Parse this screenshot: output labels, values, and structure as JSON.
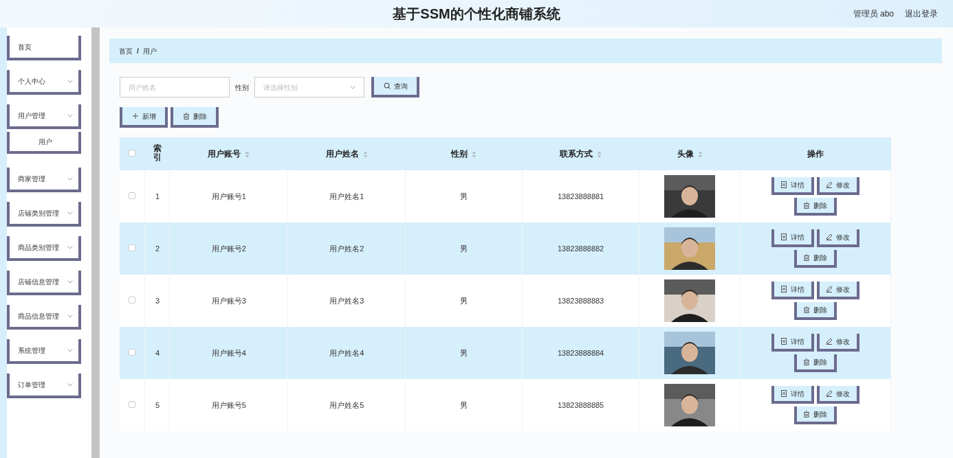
{
  "header": {
    "title": "基于SSM的个性化商铺系统",
    "user": "管理员 abo",
    "logout": "退出登录"
  },
  "sidebar": {
    "items": [
      {
        "label": "首页",
        "kind": "link"
      },
      {
        "label": "个人中心",
        "kind": "menu"
      },
      {
        "label": "用户管理",
        "kind": "menu",
        "children": [
          {
            "label": "用户"
          }
        ]
      },
      {
        "label": "商家管理",
        "kind": "menu"
      },
      {
        "label": "店铺类别管理",
        "kind": "menu"
      },
      {
        "label": "商品类别管理",
        "kind": "menu"
      },
      {
        "label": "店铺信息管理",
        "kind": "menu"
      },
      {
        "label": "商品信息管理",
        "kind": "menu"
      },
      {
        "label": "系统管理",
        "kind": "menu"
      },
      {
        "label": "订单管理",
        "kind": "menu"
      }
    ]
  },
  "breadcrumb": {
    "items": [
      "首页",
      "用户"
    ],
    "separator": "/"
  },
  "search": {
    "name_placeholder": "用户姓名",
    "gender_label": "性别",
    "gender_placeholder": "请选择性别",
    "query_button": "查询"
  },
  "actions": [
    "新增",
    "删除"
  ],
  "table": {
    "select_all_checked": false,
    "columns": [
      {
        "label": "索引",
        "sortable": false
      },
      {
        "label": "用户账号",
        "sortable": true
      },
      {
        "label": "用户姓名",
        "sortable": true
      },
      {
        "label": "性别",
        "sortable": true
      },
      {
        "label": "联系方式",
        "sortable": true
      },
      {
        "label": "头像",
        "sortable": true
      },
      {
        "label": "操作",
        "sortable": false
      }
    ],
    "rows": [
      {
        "index": "1",
        "account": "用户账号1",
        "name": "用户姓名1",
        "gender": "男",
        "phone": "13823888881",
        "checked": false,
        "buttons": [
          "详情",
          "修改",
          "删除"
        ]
      },
      {
        "index": "2",
        "account": "用户账号2",
        "name": "用户姓名2",
        "gender": "男",
        "phone": "13823888882",
        "checked": false,
        "buttons": [
          "详情",
          "修改",
          "删除"
        ]
      },
      {
        "index": "3",
        "account": "用户账号3",
        "name": "用户姓名3",
        "gender": "男",
        "phone": "13823888883",
        "checked": false,
        "buttons": [
          "详情",
          "修改",
          "删除"
        ]
      },
      {
        "index": "4",
        "account": "用户账号4",
        "name": "用户姓名4",
        "gender": "男",
        "phone": "13823888884",
        "checked": false,
        "buttons": [
          "详情",
          "修改",
          "删除"
        ]
      },
      {
        "index": "5",
        "account": "用户账号5",
        "name": "用户姓名5",
        "gender": "男",
        "phone": "13823888885",
        "checked": false,
        "buttons": [
          "详情",
          "修改",
          "删除"
        ]
      }
    ]
  }
}
